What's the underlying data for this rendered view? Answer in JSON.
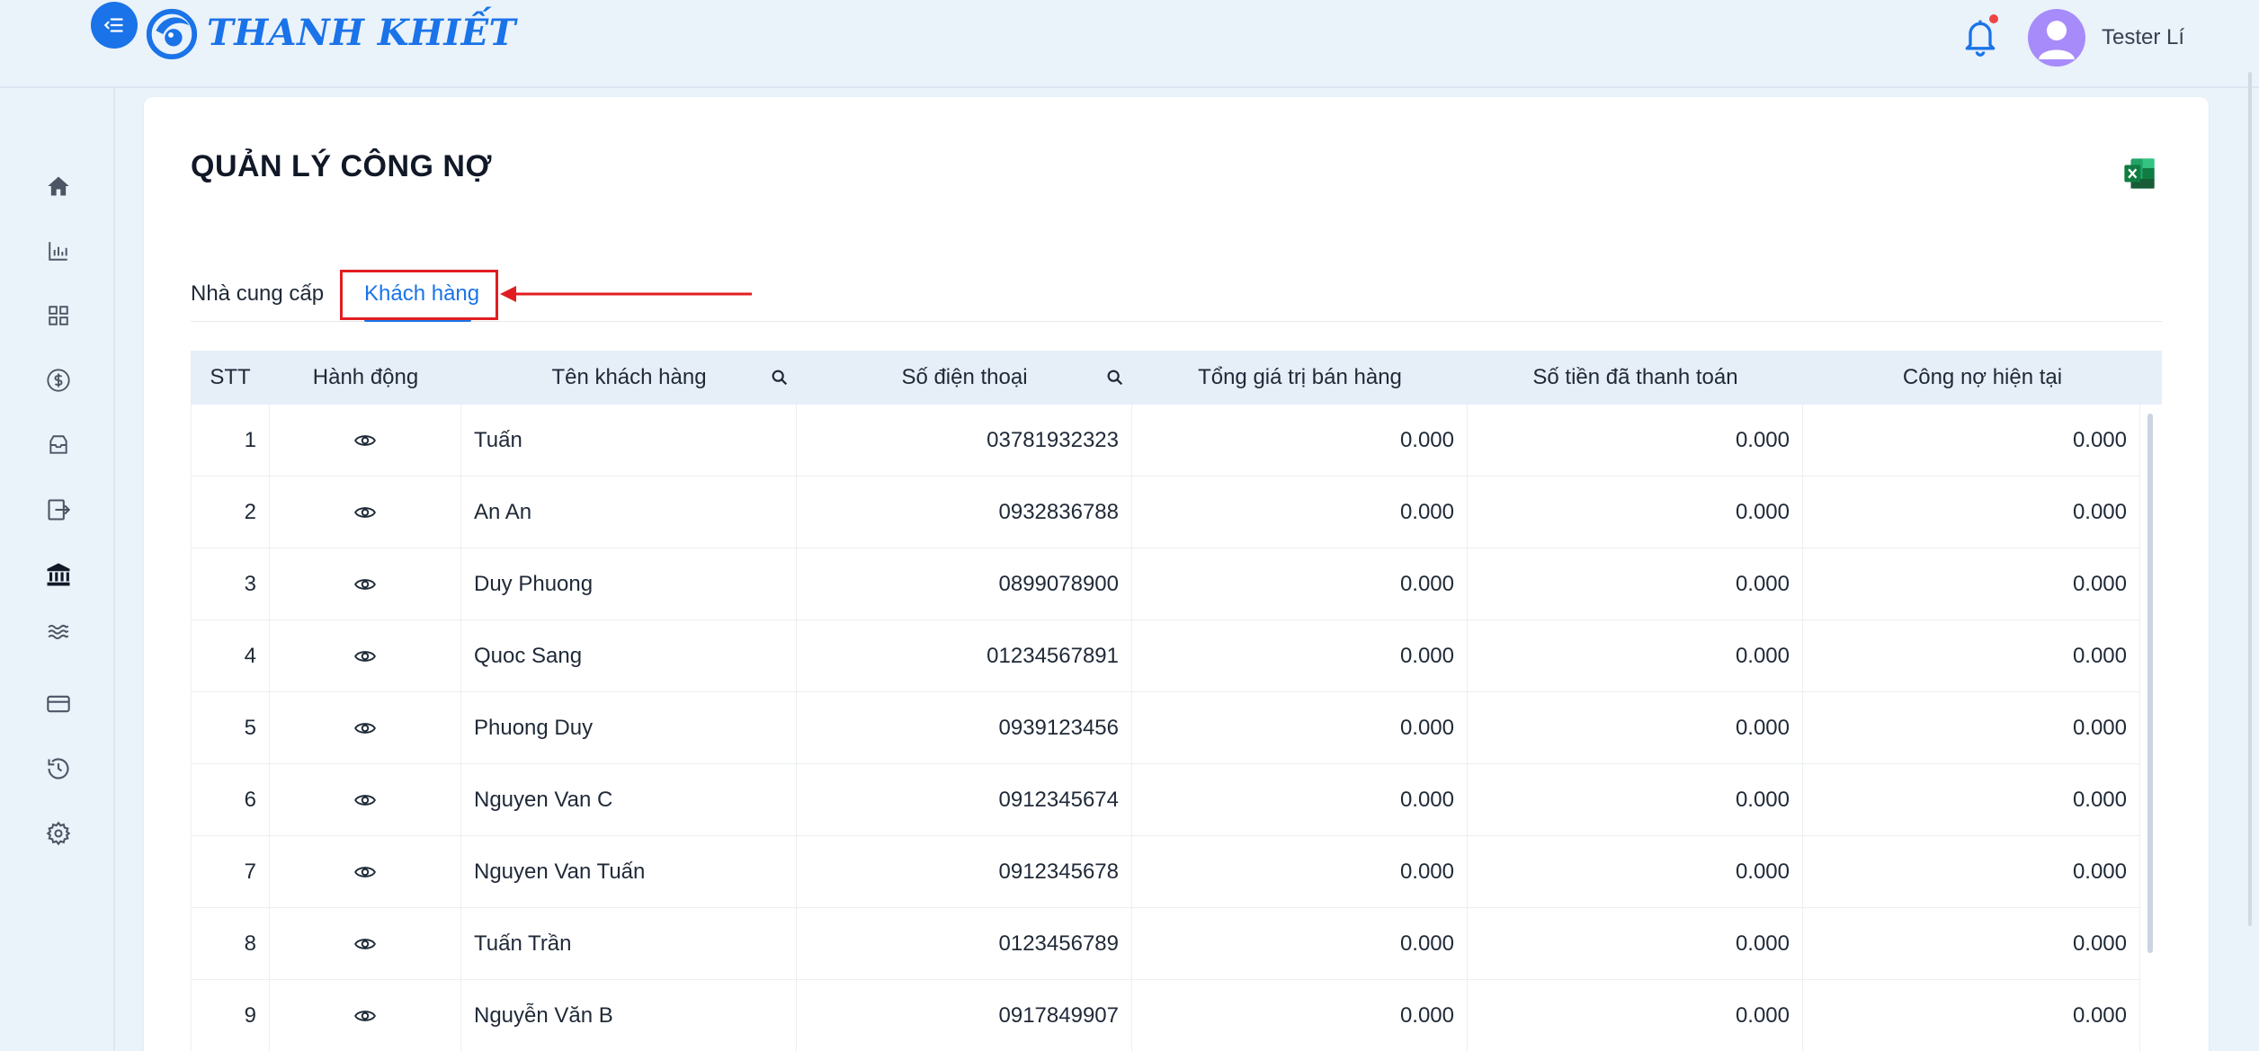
{
  "header": {
    "brand": "THANH KHIẾT",
    "user_name": "Tester Lí",
    "colors": {
      "brand": "#1a73e8",
      "notification": "#ef4444"
    }
  },
  "sidebar": {
    "items": [
      {
        "icon": "home-icon"
      },
      {
        "icon": "bar-chart-icon"
      },
      {
        "icon": "grid-icon"
      },
      {
        "icon": "dollar-icon"
      },
      {
        "icon": "inbox-icon"
      },
      {
        "icon": "export-icon"
      },
      {
        "icon": "bank-icon"
      },
      {
        "icon": "waves-icon"
      },
      {
        "icon": "credit-card-icon"
      },
      {
        "icon": "history-icon"
      },
      {
        "icon": "gear-icon"
      }
    ]
  },
  "page": {
    "title": "QUẢN LÝ CÔNG NỢ"
  },
  "tabs": [
    {
      "label": "Nhà cung cấp",
      "active": false
    },
    {
      "label": "Khách hàng",
      "active": true
    }
  ],
  "table": {
    "columns": [
      "STT",
      "Hành động",
      "Tên khách hàng",
      "Số điện thoại",
      "Tổng giá trị bán hàng",
      "Số tiền đã thanh toán",
      "Công nợ hiện tại"
    ],
    "rows": [
      {
        "stt": "1",
        "name": "Tuấn",
        "phone": "03781932323",
        "total": "0.000",
        "paid": "0.000",
        "debt": "0.000"
      },
      {
        "stt": "2",
        "name": "An An",
        "phone": "0932836788",
        "total": "0.000",
        "paid": "0.000",
        "debt": "0.000"
      },
      {
        "stt": "3",
        "name": "Duy Phuong",
        "phone": "0899078900",
        "total": "0.000",
        "paid": "0.000",
        "debt": "0.000"
      },
      {
        "stt": "4",
        "name": "Quoc Sang",
        "phone": "01234567891",
        "total": "0.000",
        "paid": "0.000",
        "debt": "0.000"
      },
      {
        "stt": "5",
        "name": "Phuong Duy",
        "phone": "0939123456",
        "total": "0.000",
        "paid": "0.000",
        "debt": "0.000"
      },
      {
        "stt": "6",
        "name": "Nguyen Van C",
        "phone": "0912345674",
        "total": "0.000",
        "paid": "0.000",
        "debt": "0.000"
      },
      {
        "stt": "7",
        "name": "Nguyen Van Tuấn",
        "phone": "0912345678",
        "total": "0.000",
        "paid": "0.000",
        "debt": "0.000"
      },
      {
        "stt": "8",
        "name": "Tuấn Trần",
        "phone": "0123456789",
        "total": "0.000",
        "paid": "0.000",
        "debt": "0.000"
      },
      {
        "stt": "9",
        "name": "Nguyễn Văn B",
        "phone": "0917849907",
        "total": "0.000",
        "paid": "0.000",
        "debt": "0.000"
      }
    ]
  },
  "annotation": {
    "highlight_color": "#e11d21"
  }
}
